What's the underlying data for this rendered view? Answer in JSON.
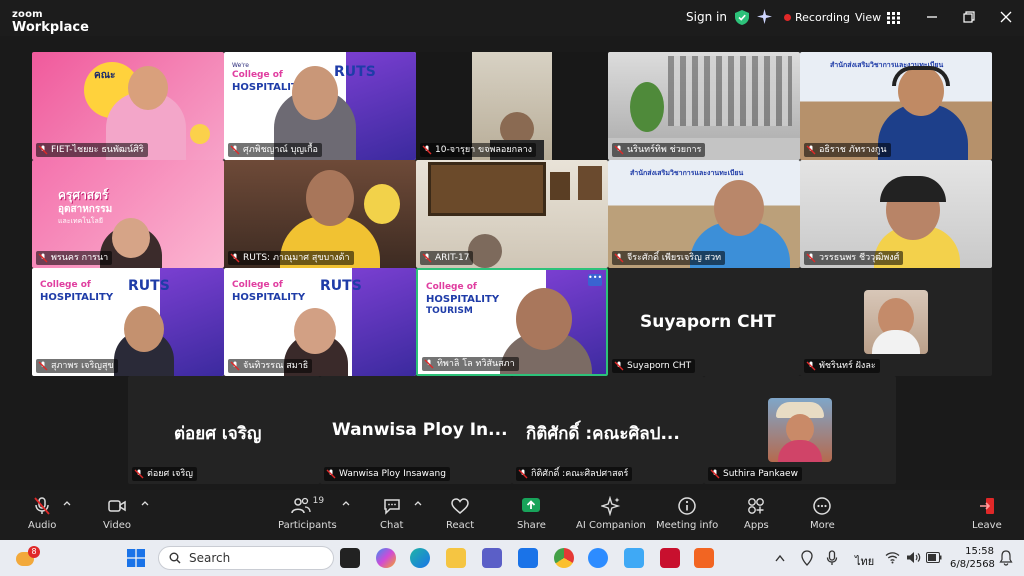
{
  "app": {
    "logo_line1": "zoom",
    "logo_line2": "Workplace"
  },
  "titlebar": {
    "sign_in": "Sign in",
    "recording": "Recording",
    "view": "View"
  },
  "participants": [
    {
      "name": "FIET-ไชยยะ ธนพัฒน์ศิริ"
    },
    {
      "name": "ศุภพิชญาณ์ บุญเกื้อ"
    },
    {
      "name": "10-จารุยา ขจพลอยกลาง"
    },
    {
      "name": "นรินทร์ทิพ ช่วยการ"
    },
    {
      "name": "อธิราช ภัทรางกูน"
    },
    {
      "name": "พรนคร การนา"
    },
    {
      "name": "RUTS: ภาณุมาศ สุขบางด้า"
    },
    {
      "name": "ARIT-17"
    },
    {
      "name": "จีระศักดิ์ เพียรเจริญ  สวท"
    },
    {
      "name": "วรรธนพร ชีววุฒิพงศ์"
    },
    {
      "name": "สุภาพร เจริญสุข"
    },
    {
      "name": "จันทิวรรณ สมาธิ"
    },
    {
      "name": "ทิพาลิ โล ทวิสันสภา"
    },
    {
      "name": "Suyaporn CHT",
      "big": "Suyaporn CHT"
    },
    {
      "name": "พัชรินทร์ ฝังละ"
    },
    {
      "name": "ต่อยศ เจริญ",
      "big": "ต่อยศ เจริญ"
    },
    {
      "name": "Wanwisa Ploy Insawang",
      "big": "Wanwisa Ploy In..."
    },
    {
      "name": "กิติศักดิ์ :คณะศิลปศาสตร์",
      "big": "กิติศักดิ์ :คณะศิลป..."
    },
    {
      "name": "Suthira Pankaew"
    }
  ],
  "slides": {
    "college": "College of",
    "hospitality": "HOSPITALITY",
    "tourism": "TOURISM",
    "were": "We're",
    "ruts": "RUTS",
    "banner": "สำนักส่งเสริมวิชาการและงานทะเบียน",
    "pink1": "คณะ",
    "pink2": "ครุศาสตร์",
    "pink3": "อุตสาหกรรม",
    "pink4": "และเทคโนโลยี"
  },
  "toolbar": {
    "audio": "Audio",
    "video": "Video",
    "participants": "Participants",
    "participants_count": "19",
    "chat": "Chat",
    "react": "React",
    "share": "Share",
    "ai": "AI Companion",
    "meeting_info": "Meeting info",
    "apps": "Apps",
    "more": "More",
    "leave": "Leave"
  },
  "taskbar": {
    "search_placeholder": "Search",
    "lang": "ไทย",
    "time": "15:58",
    "date": "6/8/2568",
    "badge": "8"
  },
  "colors": {
    "active_speaker": "#2dc27a",
    "share": "#18a35a",
    "leave": "#e02828",
    "recording": "#e02828"
  }
}
